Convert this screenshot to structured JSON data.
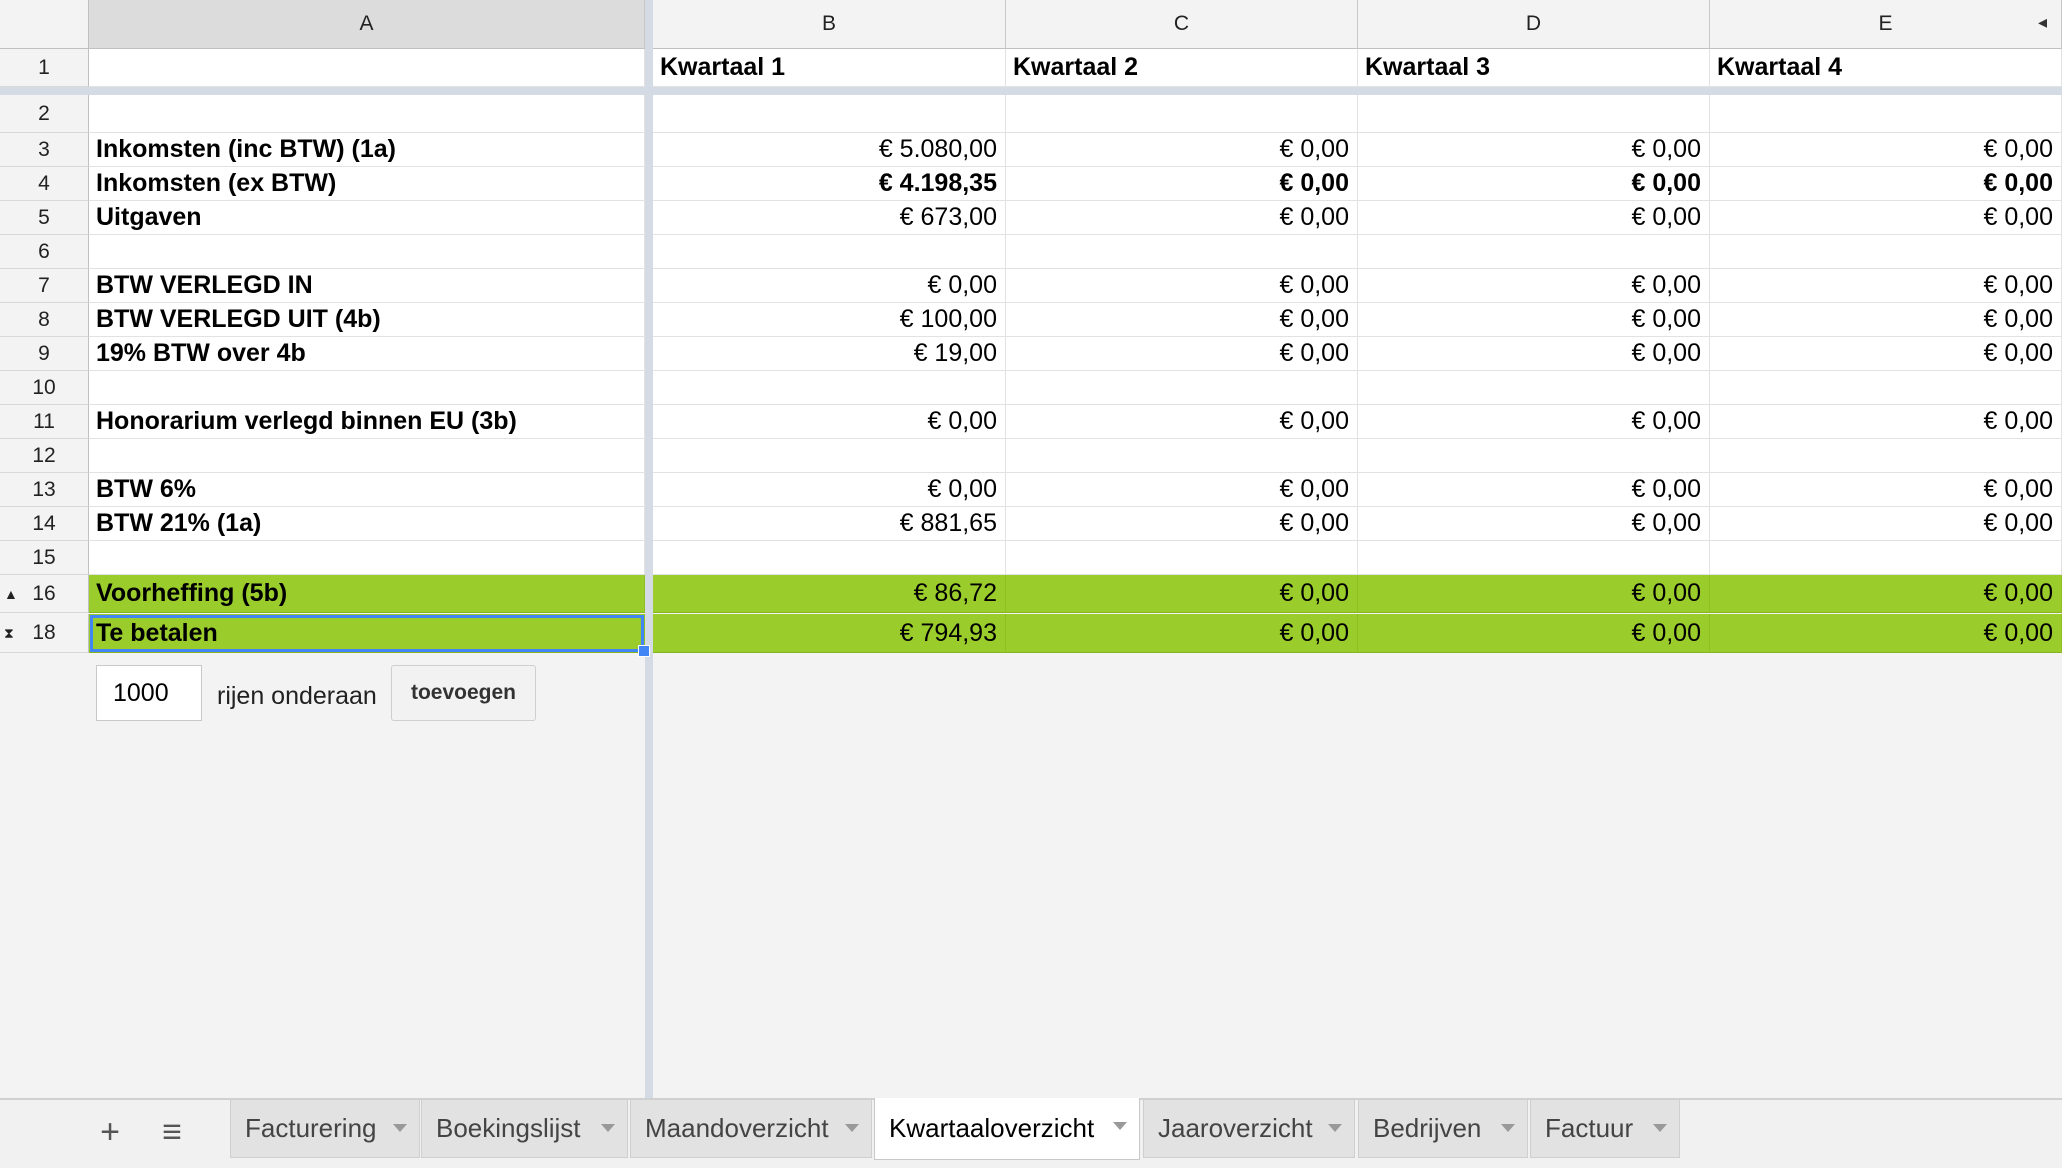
{
  "columns": {
    "a": "A",
    "b": "B",
    "c": "C",
    "d": "D",
    "e": "E"
  },
  "collapse_arrow": "◂",
  "rows": [
    {
      "num": "1",
      "label": "",
      "b": "Kwartaal 1",
      "c": "Kwartaal 2",
      "d": "Kwartaal 3",
      "e": "Kwartaal 4"
    },
    {
      "num": "2",
      "label": "",
      "b": "",
      "c": "",
      "d": "",
      "e": ""
    },
    {
      "num": "3",
      "label": "Inkomsten (inc BTW) (1a)",
      "b": "€ 5.080,00",
      "c": "€ 0,00",
      "d": "€ 0,00",
      "e": "€ 0,00"
    },
    {
      "num": "4",
      "label": "Inkomsten (ex BTW)",
      "b": "€ 4.198,35",
      "c": "€ 0,00",
      "d": "€ 0,00",
      "e": "€ 0,00"
    },
    {
      "num": "5",
      "label": "Uitgaven",
      "b": "€ 673,00",
      "c": "€ 0,00",
      "d": "€ 0,00",
      "e": "€ 0,00"
    },
    {
      "num": "6",
      "label": "",
      "b": "",
      "c": "",
      "d": "",
      "e": ""
    },
    {
      "num": "7",
      "label": "BTW VERLEGD IN",
      "b": "€ 0,00",
      "c": "€ 0,00",
      "d": "€ 0,00",
      "e": "€ 0,00"
    },
    {
      "num": "8",
      "label": "BTW VERLEGD UIT (4b)",
      "b": "€ 100,00",
      "c": "€ 0,00",
      "d": "€ 0,00",
      "e": "€ 0,00"
    },
    {
      "num": "9",
      "label": "19% BTW over 4b",
      "b": "€ 19,00",
      "c": "€ 0,00",
      "d": "€ 0,00",
      "e": "€ 0,00"
    },
    {
      "num": "10",
      "label": "",
      "b": "",
      "c": "",
      "d": "",
      "e": ""
    },
    {
      "num": "11",
      "label": "Honorarium verlegd binnen EU (3b)",
      "b": "€ 0,00",
      "c": "€ 0,00",
      "d": "€ 0,00",
      "e": "€ 0,00"
    },
    {
      "num": "12",
      "label": "",
      "b": "",
      "c": "",
      "d": "",
      "e": ""
    },
    {
      "num": "13",
      "label": "BTW 6%",
      "b": "€ 0,00",
      "c": "€ 0,00",
      "d": "€ 0,00",
      "e": "€ 0,00"
    },
    {
      "num": "14",
      "label": "BTW 21% (1a)",
      "b": "€ 881,65",
      "c": "€ 0,00",
      "d": "€ 0,00",
      "e": "€ 0,00"
    },
    {
      "num": "15",
      "label": "",
      "b": "",
      "c": "",
      "d": "",
      "e": ""
    },
    {
      "num": "16",
      "label": "Voorheffing (5b)",
      "b": "€ 86,72",
      "c": "€ 0,00",
      "d": "€ 0,00",
      "e": "€ 0,00",
      "marker": "▲"
    },
    {
      "num": "18",
      "label": "Te betalen",
      "b": "€ 794,93",
      "c": "€ 0,00",
      "d": "€ 0,00",
      "e": "€ 0,00",
      "marker": "⧗"
    }
  ],
  "add_rows": {
    "count": "1000",
    "label": "rijen onderaan",
    "button": "toevoegen"
  },
  "sheet_bar": {
    "add_icon": "+",
    "menu_icon": "≡",
    "tabs": [
      "Facturering",
      "Boekingslijst",
      "Maandoverzicht",
      "Kwartaaloverzicht",
      "Jaaroverzicht",
      "Bedrijven",
      "Factuur"
    ],
    "active_tab": "Kwartaaloverzicht"
  },
  "colors": {
    "highlight_green": "#9acd2b",
    "selection_blue": "#4285f4"
  }
}
